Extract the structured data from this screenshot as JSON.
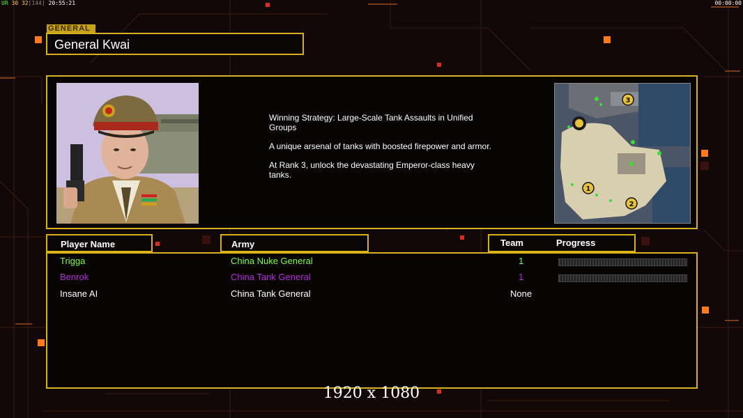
{
  "hud": {
    "left_prefix": "UR",
    "left_nums_a": "30",
    "left_nums_b": "32",
    "left_nums_c": "[144]",
    "left_time": "20:55:21",
    "right_time": "00:00:00"
  },
  "general": {
    "tag": "GENERAL",
    "name": "General Kwai",
    "description": [
      "Winning Strategy: Large-Scale Tank Assaults in Unified Groups",
      "A unique arsenal of tanks with boosted firepower and armor.",
      "At Rank 3, unlock the devastating Emperor-class heavy tanks."
    ]
  },
  "minimap": {
    "start_positions": [
      "1",
      "2",
      "3"
    ]
  },
  "table": {
    "headers": {
      "player": "Player Name",
      "army": "Army",
      "team": "Team",
      "progress": "Progress"
    },
    "rows": [
      {
        "player": "Trigga",
        "army": "China Nuke General",
        "team": "1",
        "color": "#7cff3a",
        "progress": 0.0
      },
      {
        "player": "Benrok",
        "army": "China Tank General",
        "team": "1",
        "color": "#b72be0",
        "progress": 0.0
      },
      {
        "player": "Insane AI",
        "army": "China Tank General",
        "team": "None",
        "color": "#ffffff"
      }
    ]
  },
  "resolution": "1920 x 1080",
  "colors": {
    "frame": "#d9b21b",
    "accent_orange": "#ff7a1a",
    "background": "#120807"
  }
}
